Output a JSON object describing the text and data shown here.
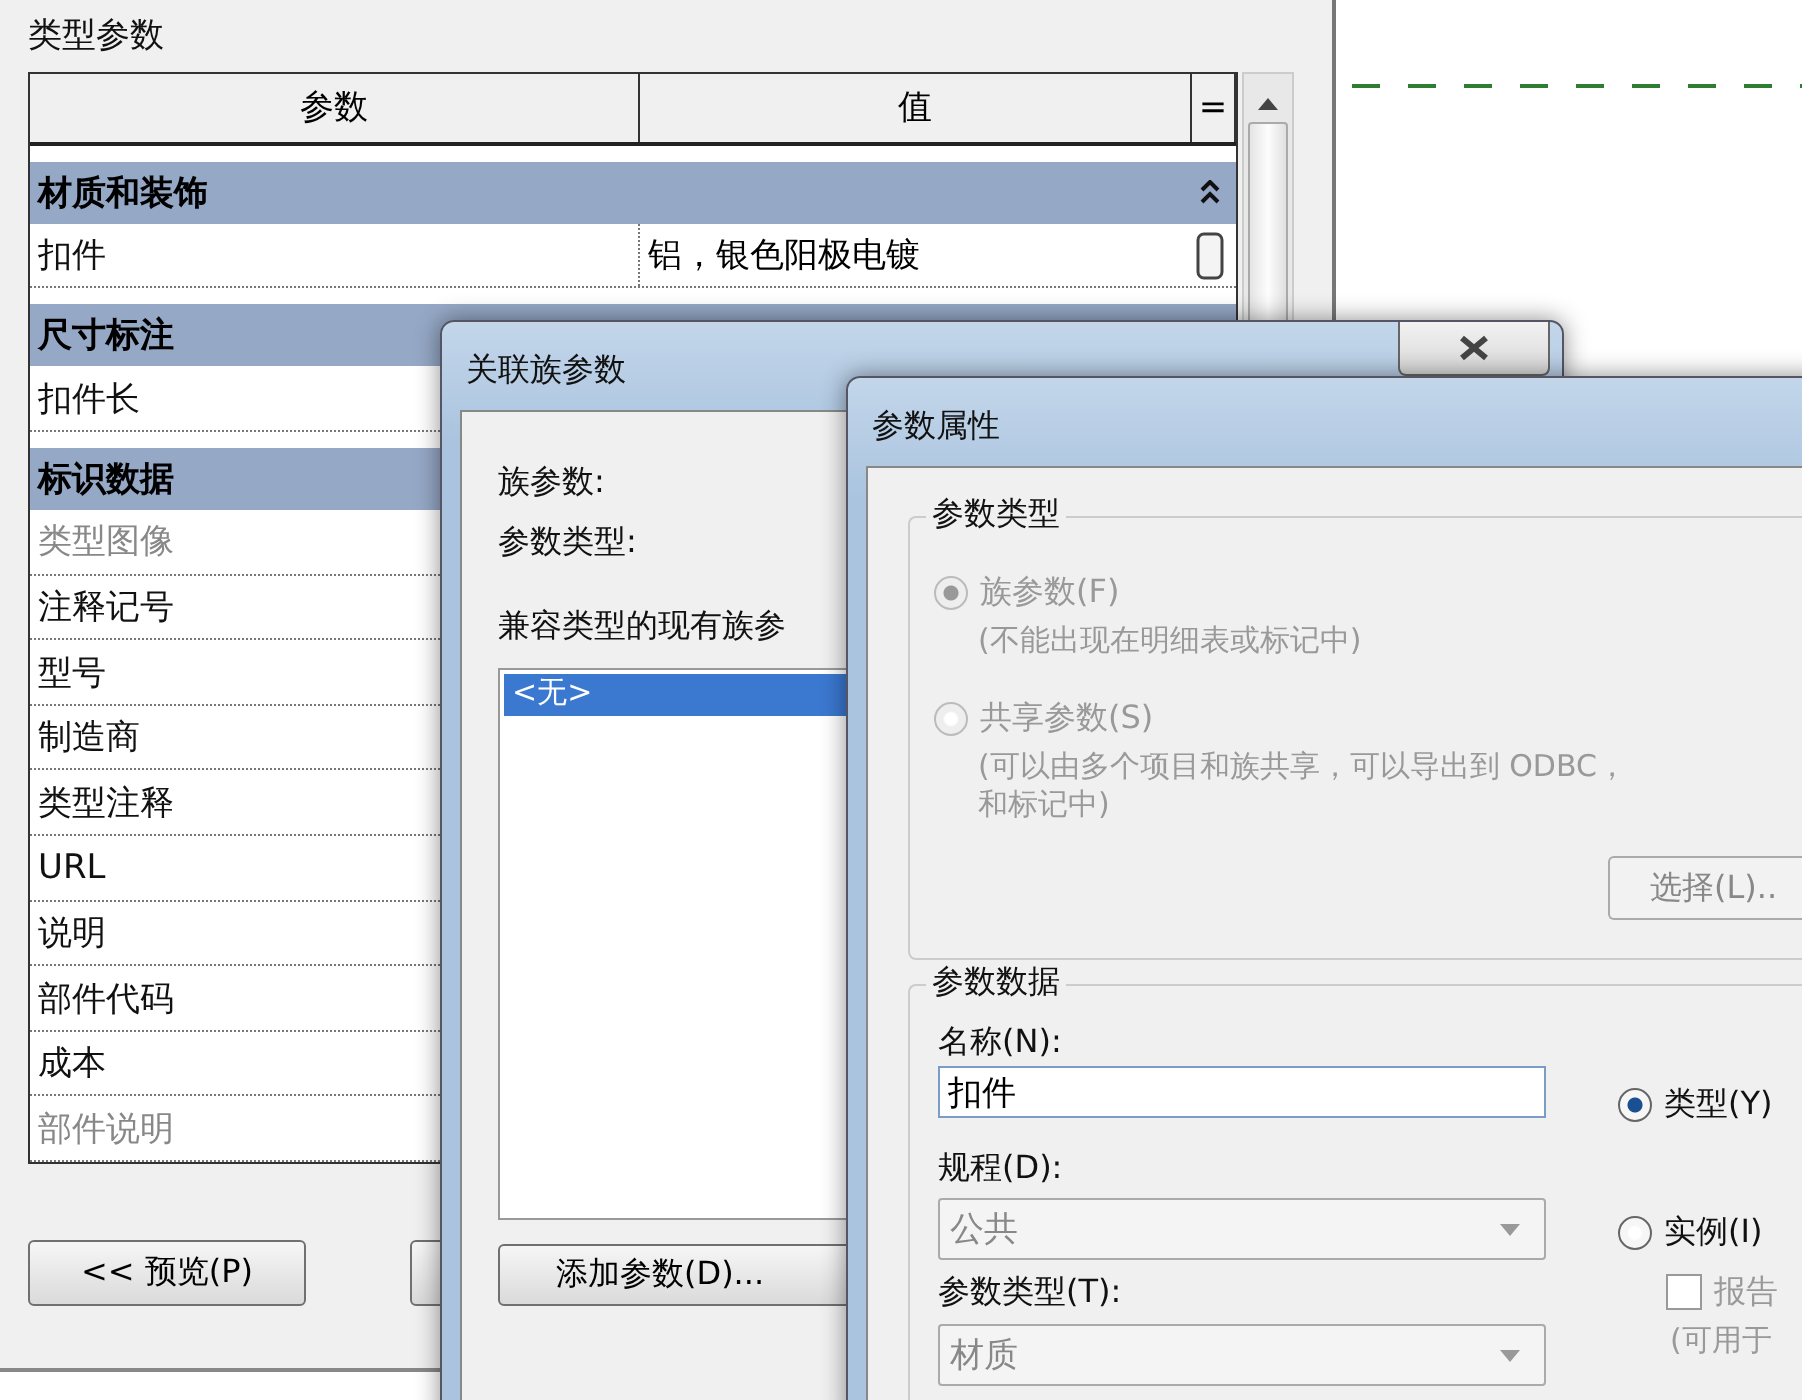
{
  "main": {
    "section_title": "类型参数",
    "columns": [
      "参数",
      "值",
      "="
    ],
    "rows": [
      {
        "kind": "group",
        "label": "材质和装饰",
        "expanded": true
      },
      {
        "kind": "param",
        "name": "扣件",
        "value": "铝，银色阳极电镀",
        "disabled": false
      },
      {
        "kind": "group",
        "label": "尺寸标注"
      },
      {
        "kind": "param",
        "name": "扣件长",
        "disabled": false
      },
      {
        "kind": "group",
        "label": "标识数据"
      },
      {
        "kind": "param",
        "name": "类型图像",
        "disabled": true
      },
      {
        "kind": "param",
        "name": "注释记号",
        "disabled": false
      },
      {
        "kind": "param",
        "name": "型号",
        "disabled": false
      },
      {
        "kind": "param",
        "name": "制造商",
        "disabled": false
      },
      {
        "kind": "param",
        "name": "类型注释",
        "disabled": false
      },
      {
        "kind": "param",
        "name": "URL",
        "disabled": false
      },
      {
        "kind": "param",
        "name": "说明",
        "disabled": false
      },
      {
        "kind": "param",
        "name": "部件代码",
        "disabled": false
      },
      {
        "kind": "param",
        "name": "成本",
        "disabled": false
      },
      {
        "kind": "param",
        "name": "部件说明",
        "disabled": true
      }
    ],
    "preview_button": "<< 预览(P)"
  },
  "associate_dialog": {
    "title": "关联族参数",
    "labels": [
      "族参数:",
      "参数类型:"
    ],
    "list_label": "兼容类型的现有族参",
    "list_items": [
      {
        "label": "<无>",
        "selected": true
      }
    ],
    "add_button": "添加参数(D)..."
  },
  "properties_dialog": {
    "title": "参数属性",
    "type_group": {
      "title": "参数类型",
      "options": [
        {
          "label": "族参数(F)",
          "note": "(不能出现在明细表或标记中)",
          "selected": true,
          "disabled": true
        },
        {
          "label": "共享参数(S)",
          "note": "(可以由多个项目和族共享，可以导出到 ODBC，",
          "note_2": "和标记中)",
          "selected": false,
          "disabled": true
        }
      ],
      "select_button": "选择(L).."
    },
    "data_group": {
      "title": "参数数据",
      "name_label": "名称(N):",
      "name_value": "扣件",
      "discipline_label": "规程(D):",
      "discipline_value": "公共",
      "param_type_label": "参数类型(T):",
      "param_type_value": "材质",
      "scope": [
        {
          "label": "类型(Y)",
          "selected": true
        },
        {
          "label": "实例(I)",
          "selected": false
        }
      ],
      "report_checkbox": {
        "label": "报告",
        "checked": false
      },
      "report_note": "(可用于"
    }
  }
}
